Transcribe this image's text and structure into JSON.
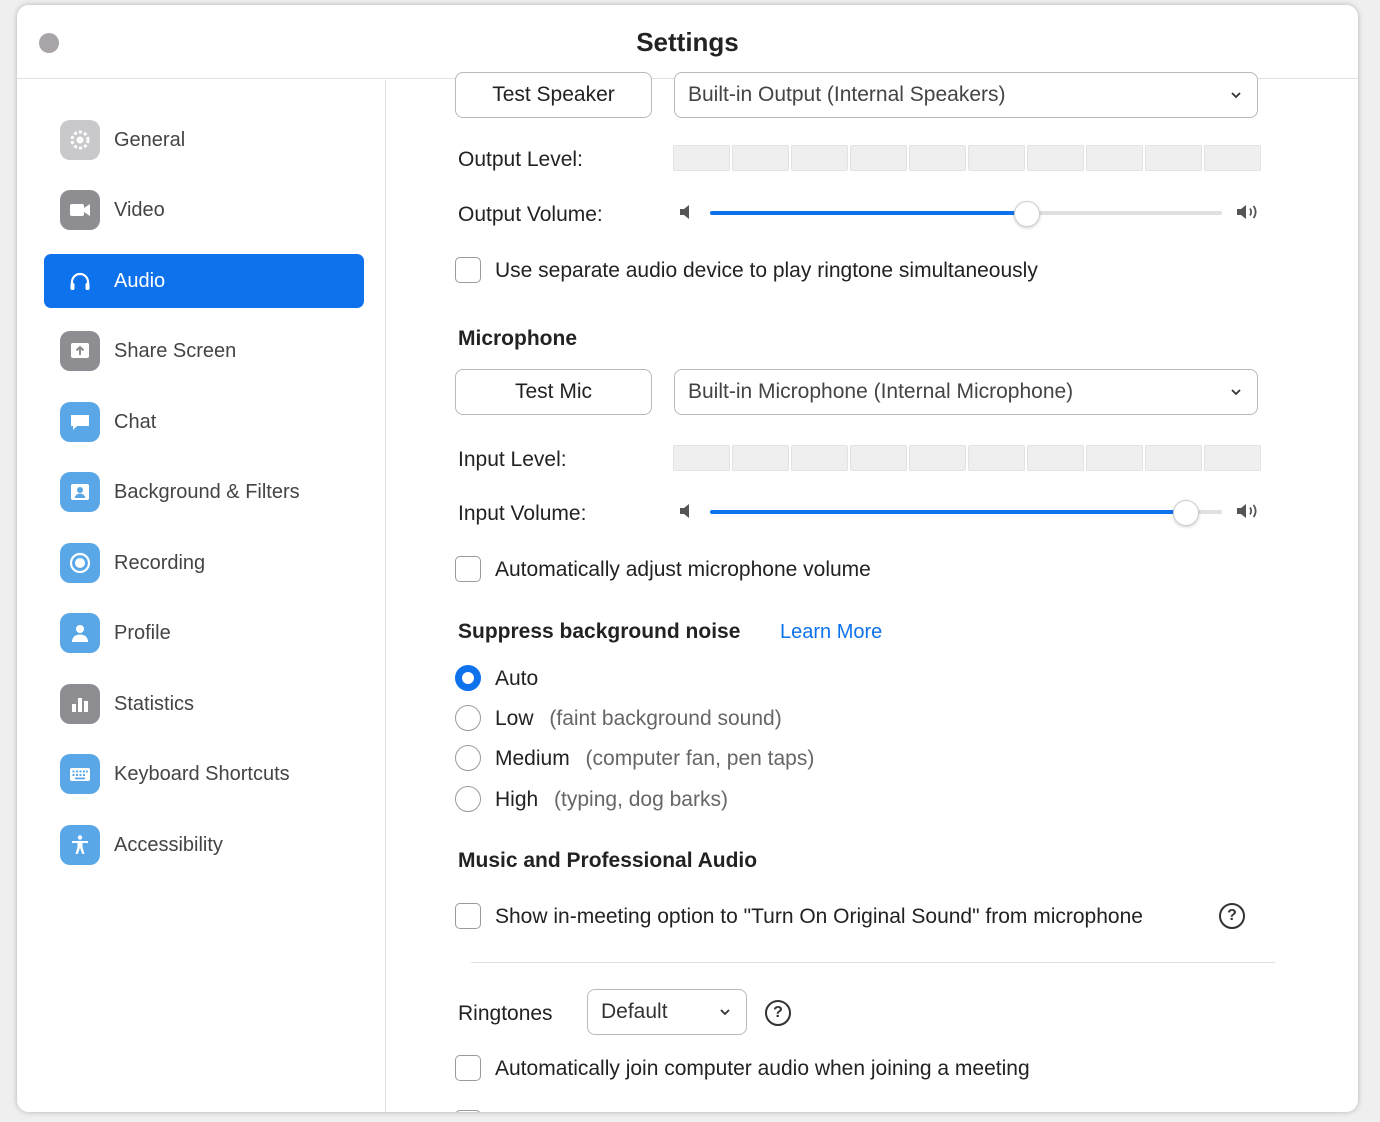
{
  "window": {
    "title": "Settings"
  },
  "sidebar": {
    "items": [
      {
        "label": "General",
        "icon": "gear-icon"
      },
      {
        "label": "Video",
        "icon": "video-camera-icon"
      },
      {
        "label": "Audio",
        "icon": "headphones-icon",
        "active": true
      },
      {
        "label": "Share Screen",
        "icon": "share-screen-icon"
      },
      {
        "label": "Chat",
        "icon": "chat-bubble-icon"
      },
      {
        "label": "Background & Filters",
        "icon": "person-portrait-icon"
      },
      {
        "label": "Recording",
        "icon": "record-icon"
      },
      {
        "label": "Profile",
        "icon": "person-icon"
      },
      {
        "label": "Statistics",
        "icon": "bar-chart-icon"
      },
      {
        "label": "Keyboard Shortcuts",
        "icon": "keyboard-icon"
      },
      {
        "label": "Accessibility",
        "icon": "accessibility-icon"
      }
    ]
  },
  "speaker": {
    "test_button": "Test Speaker",
    "device": "Built-in Output (Internal Speakers)",
    "output_level_label": "Output Level:",
    "output_level": 0,
    "output_volume_label": "Output Volume:",
    "output_volume": 0.62,
    "separate_ringtone_label": "Use separate audio device to play ringtone simultaneously",
    "separate_ringtone_checked": false
  },
  "microphone": {
    "heading": "Microphone",
    "test_button": "Test Mic",
    "device": "Built-in Microphone (Internal Microphone)",
    "input_level_label": "Input Level:",
    "input_level": 0,
    "input_volume_label": "Input Volume:",
    "input_volume": 0.93,
    "auto_adjust_label": "Automatically adjust microphone volume",
    "auto_adjust_checked": false
  },
  "noise": {
    "heading": "Suppress background noise",
    "learn_more": "Learn More",
    "selected": "Auto",
    "options": [
      {
        "label": "Auto",
        "hint": ""
      },
      {
        "label": "Low",
        "hint": "(faint background sound)"
      },
      {
        "label": "Medium",
        "hint": "(computer fan, pen taps)"
      },
      {
        "label": "High",
        "hint": "(typing, dog barks)"
      }
    ]
  },
  "music": {
    "heading": "Music and Professional Audio",
    "original_sound_label": "Show in-meeting option to \"Turn On Original Sound\" from microphone",
    "original_sound_checked": false,
    "help_glyph": "?"
  },
  "ringtones": {
    "label": "Ringtones",
    "value": "Default",
    "help_glyph": "?"
  },
  "auto_join": {
    "label": "Automatically join computer audio when joining a meeting",
    "checked": false
  },
  "colors": {
    "accent": "#0e72ed",
    "icon_blue": "#5aa7e8",
    "icon_gray": "#c9c9cc"
  }
}
